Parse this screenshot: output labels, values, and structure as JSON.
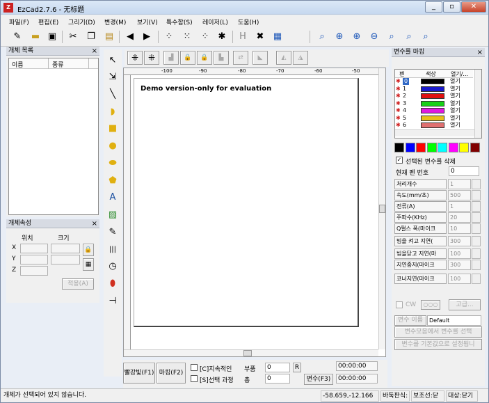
{
  "window": {
    "title": "EzCad2.7.6 - 无标题",
    "app_icon": "Z"
  },
  "menu": [
    "파일(F)",
    "편집(E)",
    "그리기(D)",
    "변경(M)",
    "보기(V)",
    "특수함(S)",
    "레이저(L)",
    "도움(H)"
  ],
  "object_list": {
    "title": "개체 목록",
    "columns": [
      "이름",
      "종류"
    ]
  },
  "object_props": {
    "title": "개체속성",
    "position_label": "위치",
    "size_label": "크기",
    "axes": [
      "X",
      "Y",
      "Z"
    ],
    "apply_label": "적용(A)"
  },
  "canvas": {
    "watermark": "Demo version-only for evaluation",
    "ruler_labels": [
      "-100",
      "-90",
      "-80",
      "-70",
      "-60",
      "-50"
    ]
  },
  "marking_panel": {
    "title": "변수를 마킹",
    "columns": [
      "펜",
      "색상",
      "열기/..."
    ],
    "pens": [
      {
        "no": "0",
        "color": "#000000",
        "state": "열기"
      },
      {
        "no": "1",
        "color": "#1a1acc",
        "state": "열기"
      },
      {
        "no": "2",
        "color": "#e01010",
        "state": "열기"
      },
      {
        "no": "3",
        "color": "#18d018",
        "state": "열기"
      },
      {
        "no": "4",
        "color": "#e018e0",
        "state": "열기"
      },
      {
        "no": "5",
        "color": "#e8c018",
        "state": "열기"
      },
      {
        "no": "6",
        "color": "#e07070",
        "state": "열기"
      }
    ],
    "palette": [
      "#000000",
      "#0000ff",
      "#ff0000",
      "#00ff00",
      "#00ffff",
      "#ff00ff",
      "#ffff00",
      "#800000"
    ],
    "delete_checkbox": "선택된 변수를 삭제",
    "current_pen_label": "현재 펜 번호",
    "current_pen_value": "0",
    "params": [
      {
        "label": "처리개수",
        "value": "1"
      },
      {
        "label": "속도(mm/초)",
        "value": "500"
      },
      {
        "label": "전류(A)",
        "value": "1"
      },
      {
        "label": "주파수(KHz)",
        "value": "20"
      },
      {
        "label": "Q펄스 폭(마이크",
        "value": "10"
      },
      {
        "label": "빔을 켜고 지연(",
        "value": "300"
      },
      {
        "label": "빔을닫고 지연(마",
        "value": "100"
      },
      {
        "label": "지연중지(마이크",
        "value": "300"
      },
      {
        "label": "코너지연(마이크",
        "value": "100"
      }
    ],
    "cw_label": "CW",
    "advanced_label": "고급...",
    "var_name_label": "변수 이름",
    "var_name_value": "Default",
    "load_btn": "변수모음에서 변수를 선택",
    "default_btn": "변수를 기본값으로 설정됩니"
  },
  "bottom": {
    "red_light": "빨강빛(F1)",
    "mark": "마킹(F2)",
    "continuous": "[C]지속적인",
    "part_label": "부품",
    "part_value": "0",
    "r_btn": "R",
    "selected": "[S]선택 과정",
    "total_label": "총",
    "total_value": "0",
    "param_btn": "변수(F3)",
    "time1": "00:00:00",
    "time2": "00:00:00"
  },
  "status": {
    "message": "개체가 선택되어 있지 않습니다.",
    "coords": "-58.659,-12.166",
    "grid": "바둑판식:",
    "guide": "보조선:닫",
    "object": "대상:닫기"
  }
}
